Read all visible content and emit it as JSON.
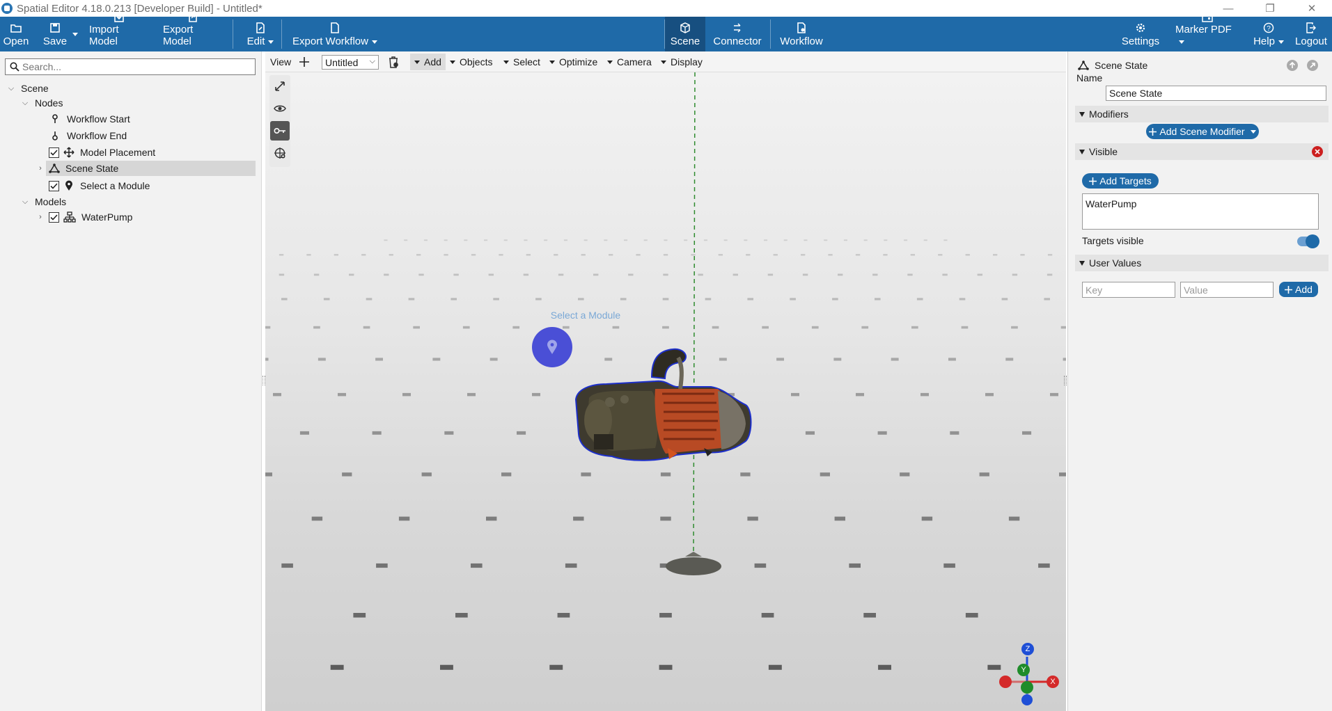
{
  "titlebar": {
    "title": "Spatial Editor 4.18.0.213 [Developer Build] - Untitled*",
    "minimize_glyph": "—",
    "restore_glyph": "❐",
    "close_glyph": "✕"
  },
  "ribbon": {
    "left": [
      {
        "label": "Open",
        "icon": "folder-open-icon"
      },
      {
        "label": "Save",
        "icon": "save-icon"
      },
      {
        "label": "Import Model",
        "icon": "import-icon"
      },
      {
        "label": "Export Model",
        "icon": "export-icon"
      },
      {
        "label": "Edit",
        "icon": "edit-icon"
      },
      {
        "label": "Export Workflow",
        "icon": "export-workflow-icon"
      }
    ],
    "center": [
      {
        "label": "Scene",
        "icon": "scene-icon",
        "active": true
      },
      {
        "label": "Connector",
        "icon": "connector-icon"
      },
      {
        "label": "Workflow",
        "icon": "workflow-icon"
      }
    ],
    "right": [
      {
        "label": "Settings",
        "icon": "gear-icon"
      },
      {
        "label": "Marker PDF",
        "icon": "marker-pdf-icon"
      },
      {
        "label": "Help",
        "icon": "help-icon"
      },
      {
        "label": "Logout",
        "icon": "logout-icon"
      }
    ],
    "colors": {
      "bar": "#1f6aa8",
      "active": "#174f80"
    }
  },
  "left_panel": {
    "search_placeholder": "Search...",
    "tree": {
      "scene": "Scene",
      "nodes": "Nodes",
      "workflow_start": "Workflow Start",
      "workflow_end": "Workflow End",
      "model_placement": "Model Placement",
      "scene_state": "Scene State",
      "select_module": "Select a Module",
      "models": "Models",
      "waterpump": "WaterPump"
    }
  },
  "viewport_toolbar": {
    "view": "View",
    "untitled": "Untitled",
    "add": "Add",
    "objects": "Objects",
    "select": "Select",
    "optimize": "Optimize",
    "camera": "Camera",
    "display": "Display"
  },
  "viewport": {
    "marker_label": "Select a Module",
    "axis": {
      "z": "Z",
      "y": "Y",
      "x": "X"
    },
    "colors": {
      "marker": "#4a4fd6",
      "axis_x": "#d42a2a",
      "axis_y": "#1f8c2a",
      "axis_z": "#1f4fd6",
      "guide": "#2e8b2e"
    }
  },
  "right_panel": {
    "header": "Scene State",
    "name_label": "Name",
    "name_value": "Scene State",
    "modifiers_label": "Modifiers",
    "add_scene_modifier": "Add Scene Modifier",
    "visible_label": "Visible",
    "add_targets": "Add Targets",
    "targets": [
      "WaterPump"
    ],
    "targets_visible_label": "Targets visible",
    "targets_visible": true,
    "user_values_label": "User Values",
    "key_placeholder": "Key",
    "value_placeholder": "Value",
    "add_label": "Add"
  }
}
